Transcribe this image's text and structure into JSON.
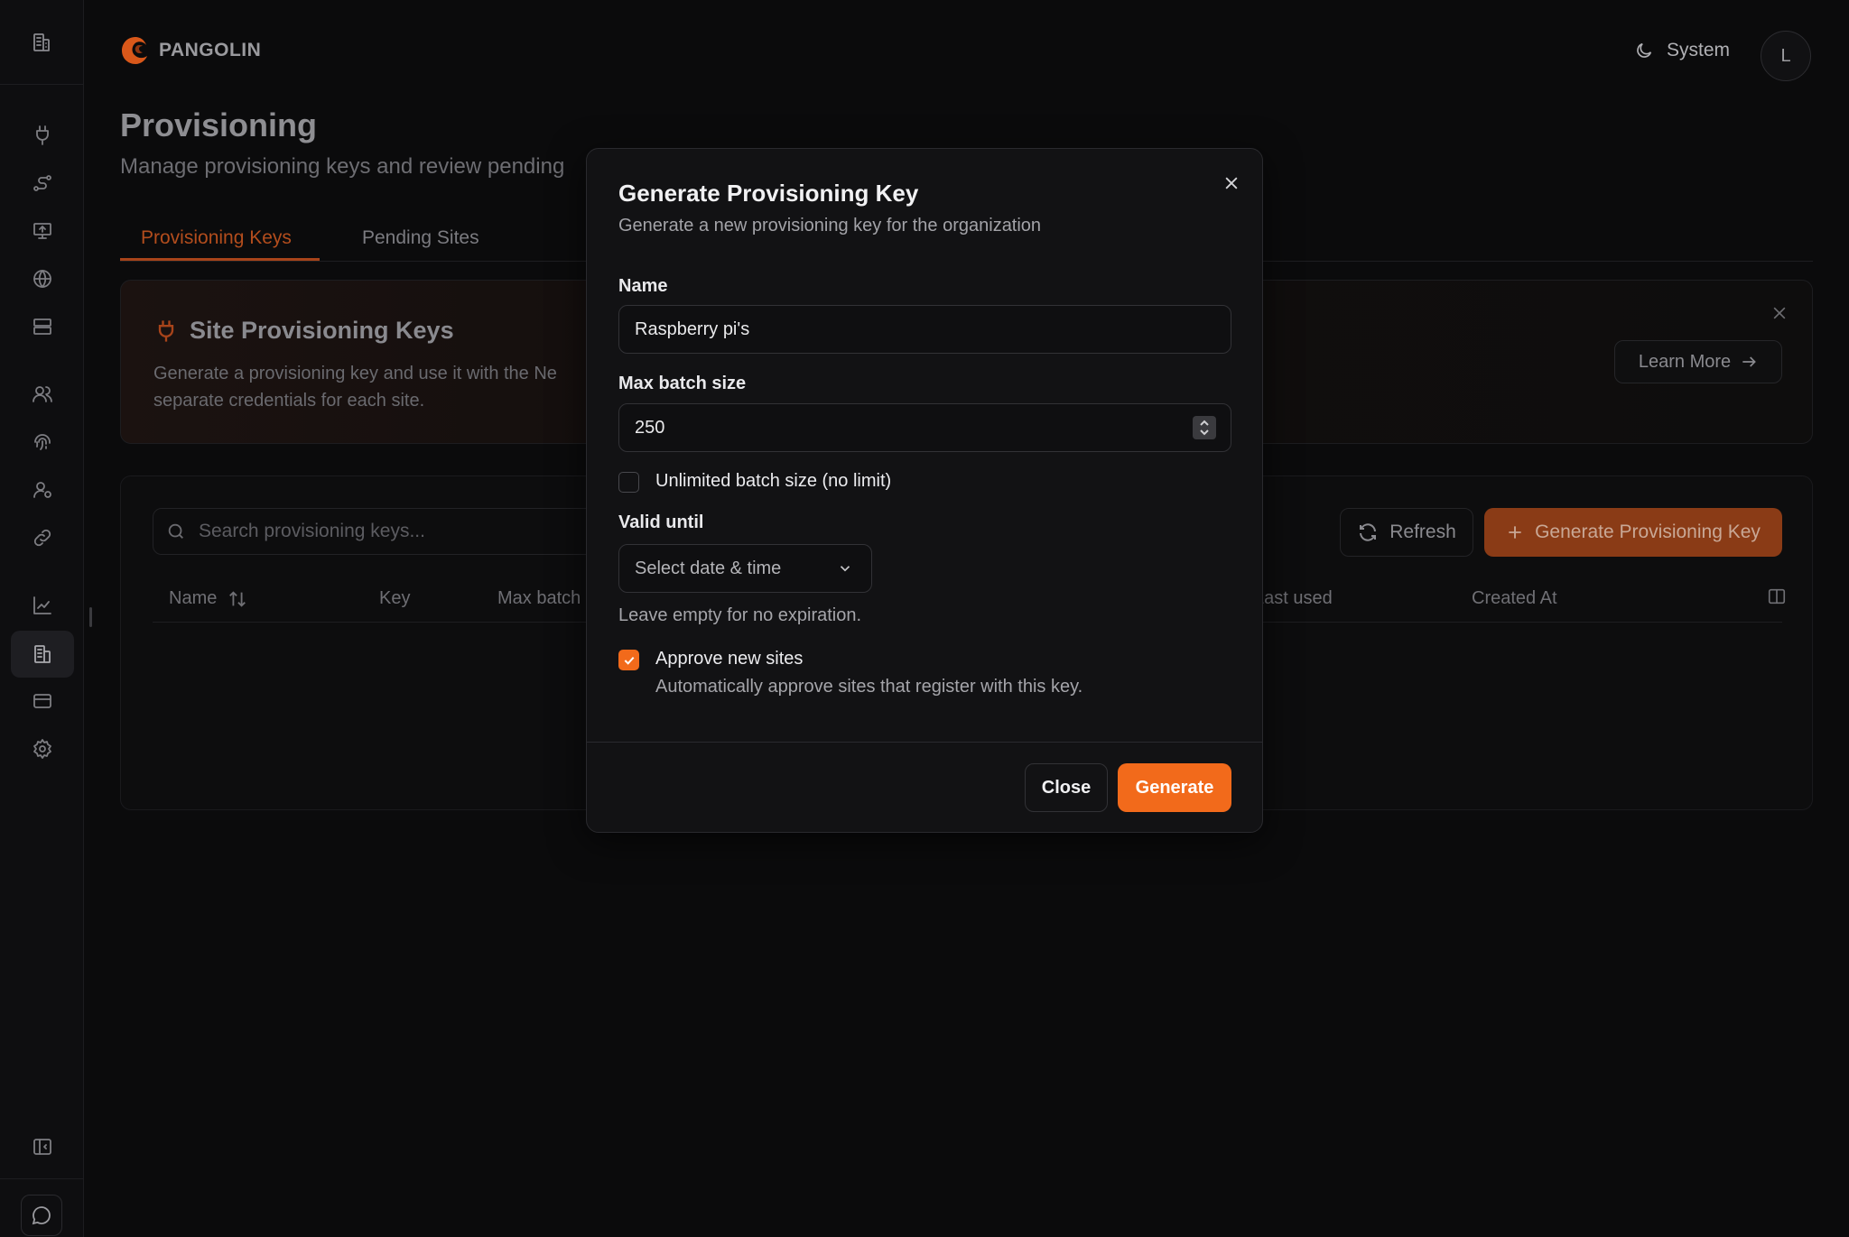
{
  "app": {
    "name": "PANGOLIN"
  },
  "header": {
    "theme_label": "System",
    "avatar_initial": "L"
  },
  "sidebar": {
    "items": [
      {
        "icon": "building-icon"
      },
      {
        "icon": "plug-icon"
      },
      {
        "icon": "route-icon"
      },
      {
        "icon": "monitor-icon"
      },
      {
        "icon": "globe-icon"
      },
      {
        "icon": "server-icon"
      },
      {
        "icon": "users-icon"
      },
      {
        "icon": "fingerprint-icon"
      },
      {
        "icon": "user-cog-icon"
      },
      {
        "icon": "link-icon"
      },
      {
        "icon": "chart-icon"
      },
      {
        "icon": "building-icon",
        "active": true
      },
      {
        "icon": "credit-card-icon"
      },
      {
        "icon": "gear-icon"
      },
      {
        "icon": "panel-collapse-icon"
      }
    ]
  },
  "page": {
    "title": "Provisioning",
    "subtitle": "Manage provisioning keys and review pending",
    "tabs": [
      {
        "label": "Provisioning Keys",
        "active": true
      },
      {
        "label": "Pending Sites",
        "active": false
      }
    ]
  },
  "info_card": {
    "title": "Site Provisioning Keys",
    "desc_line1": "Generate a provisioning key and use it with the Ne",
    "desc_line2": "separate credentials for each site.",
    "learn_more": "Learn More"
  },
  "table": {
    "search_placeholder": "Search provisioning keys...",
    "refresh_label": "Refresh",
    "generate_label": "Generate Provisioning Key",
    "columns": [
      "Name",
      "Key",
      "Max batch",
      "Last used",
      "Created At"
    ]
  },
  "modal": {
    "title": "Generate Provisioning Key",
    "description": "Generate a new provisioning key for the organization",
    "name_label": "Name",
    "name_value": "Raspberry pi's",
    "batch_label": "Max batch size",
    "batch_value": "250",
    "unlimited_label": "Unlimited batch size (no limit)",
    "unlimited_checked": false,
    "valid_label": "Valid until",
    "valid_placeholder": "Select date & time",
    "valid_hint": "Leave empty for no expiration.",
    "approve_label": "Approve new sites",
    "approve_help": "Automatically approve sites that register with this key.",
    "approve_checked": true,
    "close_label": "Close",
    "generate_label": "Generate"
  },
  "colors": {
    "accent": "#f26a1b",
    "background": "#0b0b0c",
    "modal_bg": "#121214"
  }
}
